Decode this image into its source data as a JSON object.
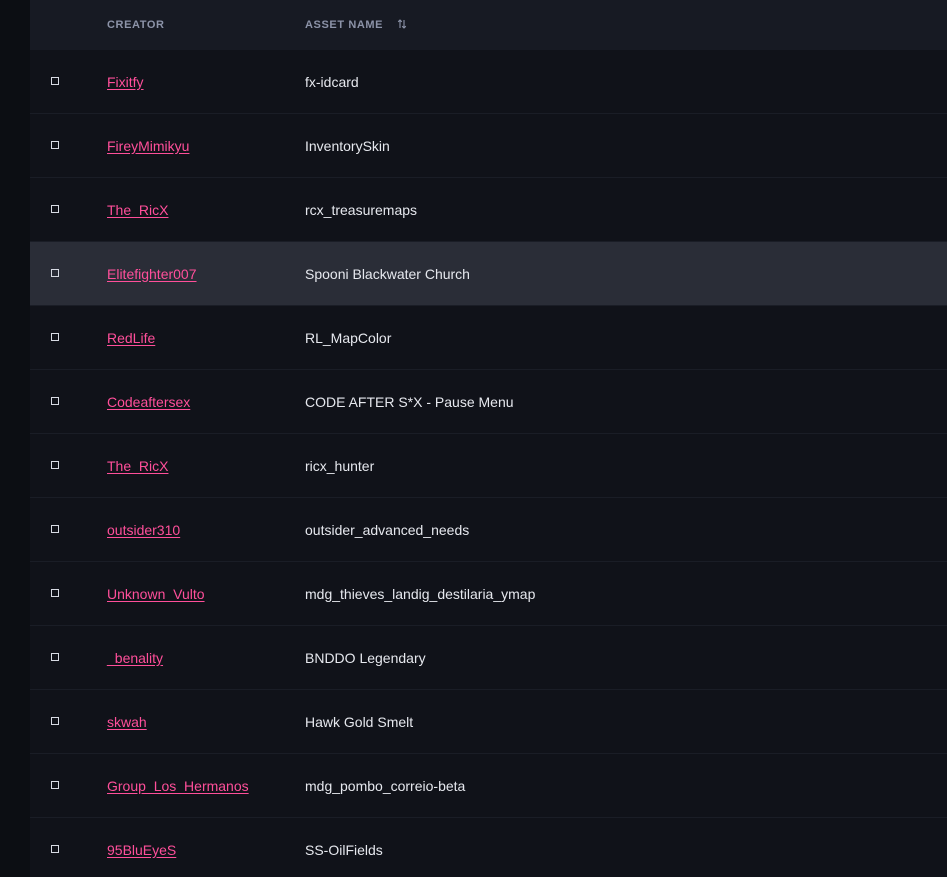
{
  "header": {
    "creator_label": "CREATOR",
    "asset_name_label": "ASSET NAME",
    "sort_icon": "sort-arrows-icon"
  },
  "colors": {
    "background": "#101219",
    "header_background": "#171a23",
    "highlight_row": "#2a2d37",
    "creator_link": "#ff4f9a",
    "asset_text": "#e6e8ee",
    "header_text": "#8c93a8"
  },
  "rows": [
    {
      "creator": "Fixitfy",
      "asset": "fx-idcard"
    },
    {
      "creator": "FireyMimikyu",
      "asset": "InventorySkin"
    },
    {
      "creator": "The_RicX",
      "asset": "rcx_treasuremaps"
    },
    {
      "creator": "Elitefighter007",
      "asset": "Spooni Blackwater Church",
      "highlighted": true
    },
    {
      "creator": "RedLife",
      "asset": "RL_MapColor"
    },
    {
      "creator": "Codeaftersex",
      "asset": "CODE AFTER S*X - Pause Menu"
    },
    {
      "creator": "The_RicX",
      "asset": "ricx_hunter"
    },
    {
      "creator": "outsider310",
      "asset": "outsider_advanced_needs"
    },
    {
      "creator": "Unknown_Vulto",
      "asset": "mdg_thieves_landig_destilaria_ymap"
    },
    {
      "creator": "_benality",
      "asset": "BNDDO Legendary"
    },
    {
      "creator": "skwah",
      "asset": "Hawk Gold Smelt"
    },
    {
      "creator": "Group_Los_Hermanos",
      "asset": "mdg_pombo_correio-beta"
    },
    {
      "creator": "95BluEyeS",
      "asset": "SS-OilFields"
    }
  ]
}
